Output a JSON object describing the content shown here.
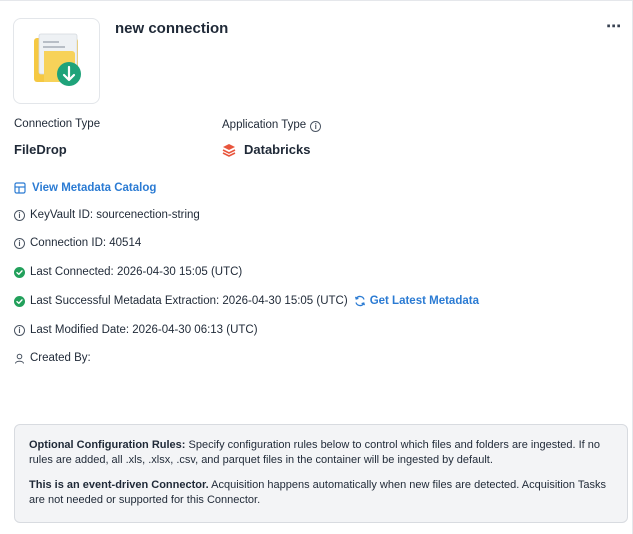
{
  "header": {
    "title": "new connection",
    "more_label": "⋯"
  },
  "icon": {
    "name": "file-drop-icon",
    "folder_color": "#f5c842",
    "badge_color": "#1fa37a"
  },
  "connection_type": {
    "label": "Connection Type",
    "value": "FileDrop"
  },
  "application_type": {
    "label": "Application Type",
    "value": "Databricks",
    "info": "i",
    "brand_color": "#e8553d"
  },
  "metadata_link": "View Metadata Catalog",
  "details": {
    "keyvault": "KeyVault ID: sourcenection-string",
    "connection_id": "Connection ID: 40514",
    "last_connected": "Last Connected: 2026-04-30 15:05 (UTC)",
    "last_metadata": "Last Successful Metadata Extraction: 2026-04-30 15:05 (UTC)",
    "get_latest": "Get Latest Metadata",
    "last_modified": "Last Modified Date: 2026-04-30 06:13 (UTC)",
    "created_by": "Created By:"
  },
  "config": {
    "rules_heading": "Optional Configuration Rules:",
    "rules_text": " Specify configuration rules below to control which files and folders are ingested. If no rules are added, all .xls, .xlsx, .csv, and parquet files in the container will be ingested by default.",
    "event_heading": "This is an event-driven Connector.",
    "event_text": " Acquisition happens automatically when new files are detected. Acquisition Tasks are not needed or supported for this Connector."
  },
  "colors": {
    "accent": "#2b7bd3",
    "success": "#22a05b"
  }
}
